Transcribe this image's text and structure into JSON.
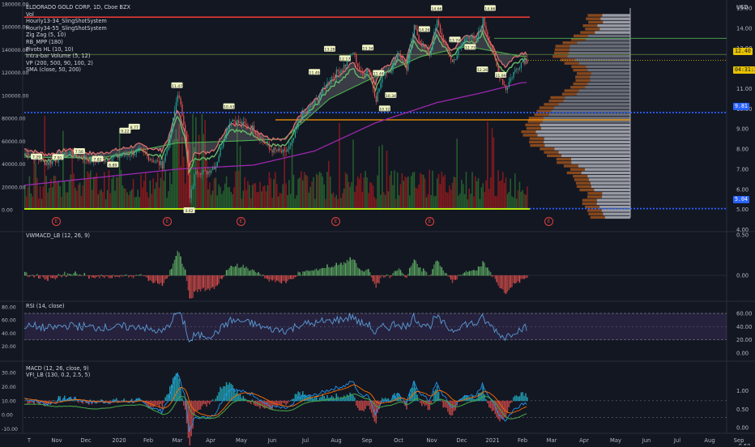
{
  "chart_data": {
    "type": "line",
    "legend": {
      "title": "ELDORADO GOLD CORP, 1D, Cboe BZX",
      "lines": [
        "Vol",
        "Hourly13-34_SlingShotSystem",
        "Hourly34-55_SlingShotSystem",
        "Zig Zag (5, 10)",
        "RB_MPP (180)",
        "Pivots HL (10, 10)",
        "Intra-bar Volume (5, 12)",
        "VP (200, 500, 90, 100, 2)",
        "SMA (close, 50, 200)"
      ]
    },
    "price_axis": {
      "unit": "USD",
      "ticks": [
        "15.00",
        "14.00",
        "13.00",
        "12.00",
        "11.00",
        "10.00",
        "9.00",
        "8.00",
        "7.00",
        "6.00",
        "5.00",
        "4.00"
      ],
      "min": 3.9,
      "max": 15.2,
      "last_price": "12.40",
      "countdown": "04:31:37",
      "level_tags": [
        "9.81",
        "5.04"
      ],
      "level_values": [
        9.81,
        5.04
      ],
      "resistance": 14.55,
      "support": 9.45,
      "upper_green": 13.5
    },
    "volume_axis": {
      "ticks": [
        "180000.00",
        "160000.00",
        "140000.00",
        "120000.00",
        "100000.00",
        "80000.00",
        "60000.00",
        "40000.00",
        "20000.00",
        "0.00"
      ],
      "min": 0,
      "max": 180000
    },
    "time_axis": {
      "labels": [
        "T",
        "Nov",
        "Dec",
        "2020",
        "Feb",
        "Mar",
        "Apr",
        "May",
        "Jun",
        "Jul",
        "Aug",
        "Sep",
        "Oct",
        "Nov",
        "Dec",
        "2021",
        "Feb",
        "Mar",
        "Apr",
        "May",
        "Jun",
        "Jul",
        "Aug",
        "Sep"
      ]
    },
    "earnings_marker": "E",
    "price_series": {
      "name": "Close",
      "days": 330,
      "anchors": [
        [
          0,
          7.8
        ],
        [
          15,
          7.3
        ],
        [
          30,
          7.8
        ],
        [
          45,
          7.4
        ],
        [
          60,
          7.6
        ],
        [
          75,
          7.9
        ],
        [
          85,
          7.4
        ],
        [
          90,
          7.2
        ],
        [
          95,
          8.5
        ],
        [
          100,
          10.8
        ],
        [
          105,
          9.0
        ],
        [
          108,
          5.5
        ],
        [
          112,
          7.0
        ],
        [
          118,
          6.8
        ],
        [
          125,
          7.2
        ],
        [
          130,
          8.5
        ],
        [
          135,
          9.5
        ],
        [
          140,
          9.3
        ],
        [
          150,
          9.0
        ],
        [
          160,
          8.0
        ],
        [
          170,
          7.8
        ],
        [
          175,
          8.3
        ],
        [
          180,
          9.5
        ],
        [
          190,
          10.3
        ],
        [
          200,
          11.5
        ],
        [
          210,
          12.2
        ],
        [
          215,
          12.8
        ],
        [
          220,
          11.7
        ],
        [
          225,
          12.0
        ],
        [
          230,
          10.5
        ],
        [
          235,
          11.8
        ],
        [
          240,
          12.0
        ],
        [
          245,
          12.8
        ],
        [
          250,
          12.0
        ],
        [
          255,
          14.0
        ],
        [
          260,
          13.2
        ],
        [
          265,
          12.7
        ],
        [
          270,
          14.3
        ],
        [
          275,
          13.2
        ],
        [
          280,
          12.3
        ],
        [
          285,
          13.0
        ],
        [
          290,
          13.7
        ],
        [
          295,
          13.3
        ],
        [
          300,
          14.4
        ],
        [
          305,
          13.2
        ],
        [
          310,
          11.8
        ],
        [
          315,
          11.0
        ],
        [
          320,
          11.8
        ],
        [
          326,
          12.4
        ]
      ]
    },
    "zigzag_labels": [
      "7.29",
      "7.91",
      "7.56",
      "7.82",
      "6.89",
      "9.22",
      "8.77",
      "11.47",
      "4.62",
      "10.43",
      "11.49",
      "13.28",
      "12.17",
      "13.34",
      "11.44",
      "10.32",
      "10.34",
      "14.26",
      "14.66",
      "13.74",
      "12.73",
      "12.26",
      "14.66",
      "11.99"
    ],
    "sma50": [
      [
        0,
        7.6
      ],
      [
        50,
        7.55
      ],
      [
        100,
        8.3
      ],
      [
        140,
        8.4
      ],
      [
        170,
        8.5
      ],
      [
        200,
        10.5
      ],
      [
        230,
        11.6
      ],
      [
        260,
        12.6
      ],
      [
        290,
        13.1
      ],
      [
        326,
        12.6
      ]
    ],
    "sma200": [
      [
        0,
        6.2
      ],
      [
        100,
        7.0
      ],
      [
        150,
        7.2
      ],
      [
        190,
        7.9
      ],
      [
        230,
        9.3
      ],
      [
        270,
        10.3
      ],
      [
        300,
        10.8
      ],
      [
        326,
        11.3
      ]
    ],
    "vwmacd": {
      "name": "VWMACD_LB (12, 26, 9)",
      "ticks": [
        "0.50",
        "0.00"
      ],
      "min": -0.3,
      "max": 0.5
    },
    "rsi": {
      "name": "RSI (14, close)",
      "ticks_left": [
        "80.00",
        "60.00",
        "40.00",
        "20.00"
      ],
      "ticks_right": [
        "60.00",
        "40.00",
        "20.00",
        "0.00"
      ],
      "upper": 70,
      "lower": 30
    },
    "macd": {
      "name": "MACD (12, 26, close, 9)",
      "name2": "VFI_LB (130, 0.2, 2.5, 5)",
      "ticks_left": [
        "30.00",
        "20.00",
        "10.00",
        "0.00",
        "-10.00"
      ],
      "ticks_right": [
        "1.00",
        "0.50",
        "0.00",
        "-0.50"
      ]
    },
    "colors": {
      "bg": "#131722",
      "up": "#26a69a",
      "down": "#ef5350",
      "green": "#4caf50",
      "red": "#e53935",
      "sma200": "#9c27b0",
      "orange": "#ff9800",
      "blue": "#2962ff",
      "yellow": "#ffeb3b",
      "rsi": "#5b9bd5",
      "rsi_band": "#7e57c2"
    }
  }
}
